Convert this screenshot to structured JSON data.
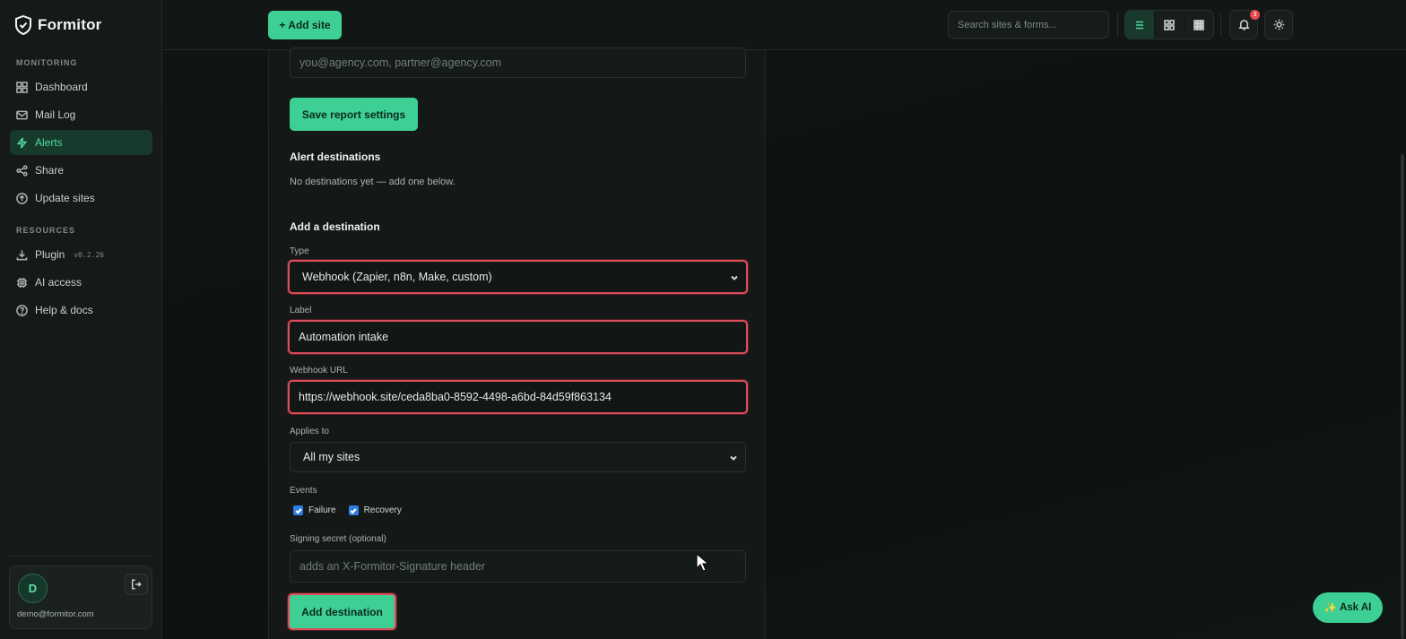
{
  "brand": {
    "name": "Formitor"
  },
  "sidebar": {
    "section_monitoring": "MONITORING",
    "section_resources": "RESOURCES",
    "items": [
      {
        "label": "Dashboard",
        "icon": "dashboard-icon"
      },
      {
        "label": "Mail Log",
        "icon": "mail-icon"
      },
      {
        "label": "Alerts",
        "icon": "bolt-icon",
        "active": true
      },
      {
        "label": "Share",
        "icon": "share-icon"
      },
      {
        "label": "Update sites",
        "icon": "upload-icon"
      },
      {
        "label": "Plugin",
        "icon": "download-icon",
        "version": "v0.2.26"
      },
      {
        "label": "AI access",
        "icon": "chip-icon"
      },
      {
        "label": "Help & docs",
        "icon": "help-icon"
      }
    ],
    "user": {
      "initial": "D",
      "email": "demo@formitor.com"
    }
  },
  "topbar": {
    "add_site_label": "+ Add site",
    "search_placeholder": "Search sites & forms...",
    "notification_count": "3"
  },
  "panel": {
    "recipients_placeholder": "you@agency.com, partner@agency.com",
    "save_report_label": "Save report settings",
    "alert_destinations_heading": "Alert destinations",
    "no_destinations_text": "No destinations yet — add one below.",
    "add_destination_heading": "Add a destination",
    "type_label": "Type",
    "type_value": "Webhook (Zapier, n8n, Make, custom)",
    "label_label": "Label",
    "label_value": "Automation intake",
    "webhook_label": "Webhook URL",
    "webhook_value": "https://webhook.site/ceda8ba0-8592-4498-a6bd-84d59f863134",
    "applies_label": "Applies to",
    "applies_value": "All my sites",
    "events_label": "Events",
    "event_failure": "Failure",
    "event_recovery": "Recovery",
    "signing_label": "Signing secret (optional)",
    "signing_placeholder": "adds an X-Formitor-Signature header",
    "add_destination_label": "Add destination"
  },
  "ask_ai": {
    "label": "Ask AI",
    "icon": "sparkle-icon"
  },
  "colors": {
    "accent": "#3ecf95",
    "highlight": "#d94e5a",
    "active_bg": "#173a2c"
  }
}
